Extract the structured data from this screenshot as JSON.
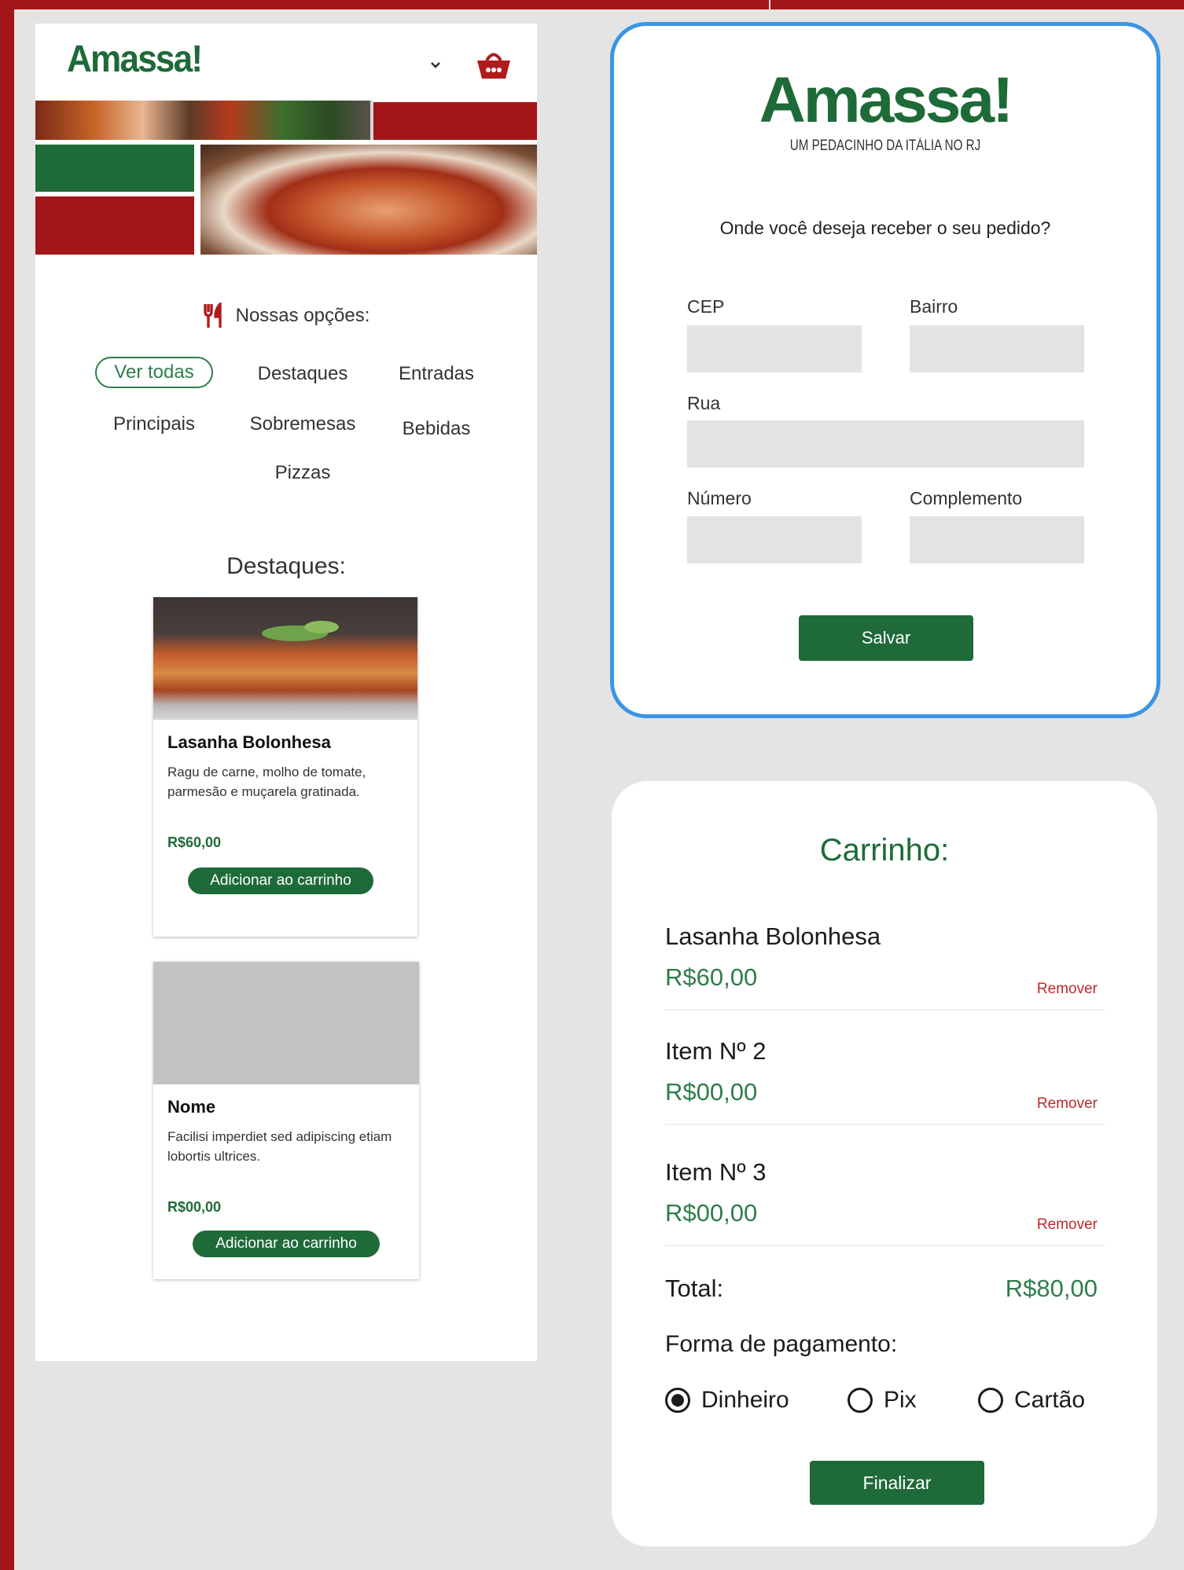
{
  "colors": {
    "brand_red": "#a31617",
    "brand_green": "#1e6a38",
    "accent_blue": "#3b95e2",
    "price_green": "#2f7d4b",
    "remove_red": "#c0282a",
    "input_gray": "#e3e3e3",
    "placeholder_gray": "#c2c2c2"
  },
  "menu_screen": {
    "logo": "Amassa!",
    "header_icons": [
      "chevron-down-icon",
      "basket-icon"
    ],
    "options_title": "Nossas opções:",
    "options_icon": "fork-knife-icon",
    "categories": [
      {
        "label": "Ver todas",
        "active": true
      },
      {
        "label": "Destaques",
        "active": false
      },
      {
        "label": "Entradas",
        "active": false
      },
      {
        "label": "Principais",
        "active": false
      },
      {
        "label": "Sobremesas",
        "active": false
      },
      {
        "label": "Bebidas",
        "active": false
      },
      {
        "label": "Pizzas",
        "active": false
      }
    ],
    "highlights_title": "Destaques:",
    "products": [
      {
        "name": "Lasanha Bolonhesa",
        "description": "Ragu de carne, molho de tomate, parmesão e muçarela gratinada.",
        "price": "R$60,00",
        "button": "Adicionar ao carrinho"
      },
      {
        "name": "Nome",
        "description": "Facilisi imperdiet sed adipiscing etiam lobortis ultrices.",
        "price": "R$00,00",
        "button": "Adicionar ao carrinho"
      }
    ]
  },
  "address_modal": {
    "logo": "Amassa!",
    "tagline": "UM PEDACINHO DA ITÁLIA NO RJ",
    "question": "Onde você deseja receber o seu pedido?",
    "fields": {
      "cep": {
        "label": "CEP",
        "value": ""
      },
      "bairro": {
        "label": "Bairro",
        "value": ""
      },
      "rua": {
        "label": "Rua",
        "value": ""
      },
      "numero": {
        "label": "Número",
        "value": ""
      },
      "complemento": {
        "label": "Complemento",
        "value": ""
      }
    },
    "save_label": "Salvar"
  },
  "cart": {
    "title": "Carrinho:",
    "items": [
      {
        "name": "Lasanha Bolonhesa",
        "price": "R$60,00",
        "remove": "Remover"
      },
      {
        "name": "Item Nº 2",
        "price": "R$00,00",
        "remove": "Remover"
      },
      {
        "name": "Item Nº 3",
        "price": "R$00,00",
        "remove": "Remover"
      }
    ],
    "total_label": "Total:",
    "total_value": "R$80,00",
    "payment_label": "Forma de pagamento:",
    "payment_options": [
      {
        "label": "Dinheiro",
        "selected": true
      },
      {
        "label": "Pix",
        "selected": false
      },
      {
        "label": "Cartão",
        "selected": false
      }
    ],
    "finish_label": "Finalizar"
  }
}
